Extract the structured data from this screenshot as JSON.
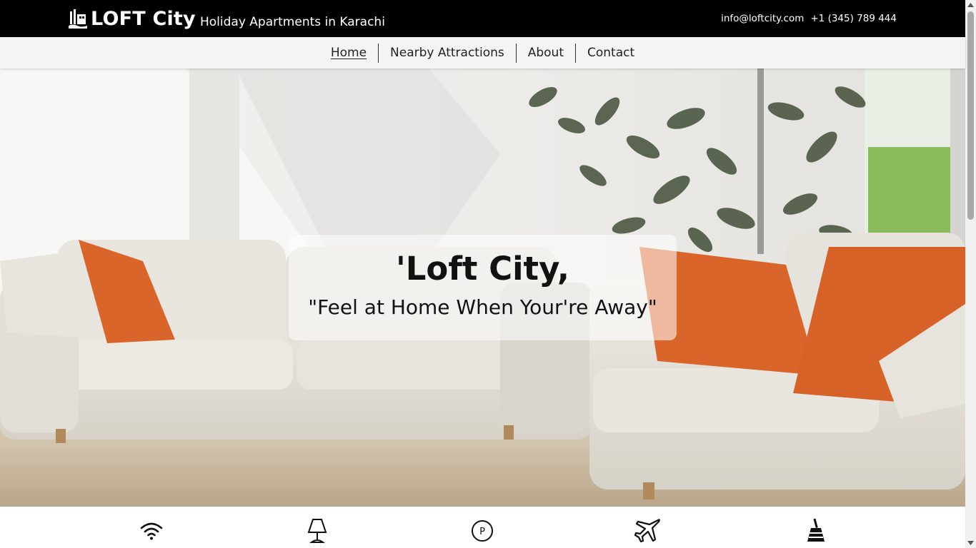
{
  "header": {
    "brand": "LOFT City",
    "tagline": "Holiday Apartments in Karachi",
    "email": "info@loftcity.com",
    "phone": "+1 (345) 789 444",
    "logo_icon": "building-logo-icon"
  },
  "nav": {
    "items": [
      {
        "label": "Home",
        "active": true
      },
      {
        "label": "Nearby Attractions",
        "active": false
      },
      {
        "label": "About",
        "active": false
      },
      {
        "label": "Contact",
        "active": false
      }
    ]
  },
  "hero": {
    "title": "'Loft City,",
    "quote": "\"Feel at Home When Your're Away\""
  },
  "amenities": [
    {
      "icon": "wifi-icon"
    },
    {
      "icon": "lamp-icon"
    },
    {
      "icon": "parking-icon"
    },
    {
      "icon": "airplane-icon"
    },
    {
      "icon": "broom-icon"
    }
  ],
  "colors": {
    "topbar_bg": "#000000",
    "nav_bg": "#f3f4f5",
    "cushion_orange": "#d9652a"
  }
}
